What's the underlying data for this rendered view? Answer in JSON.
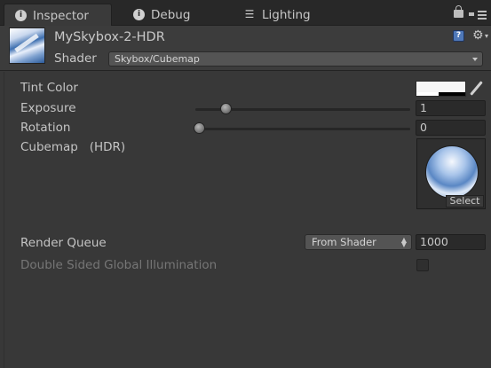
{
  "tabs": [
    {
      "label": "Inspector",
      "icon": "info-icon",
      "active": true
    },
    {
      "label": "Debug",
      "icon": "info-icon",
      "active": false
    },
    {
      "label": "Lighting",
      "icon": "lighting-icon",
      "active": false
    }
  ],
  "header": {
    "asset_name": "MySkybox-2-HDR",
    "shader_label": "Shader",
    "shader_value": "Skybox/Cubemap"
  },
  "properties": {
    "tint_color": {
      "label": "Tint Color",
      "color": "#f6f6f6"
    },
    "exposure": {
      "label": "Exposure",
      "value": "1",
      "slider_fraction": 0.13
    },
    "rotation": {
      "label": "Rotation",
      "value": "0",
      "slider_fraction": 0.0
    },
    "cubemap": {
      "label": "Cubemap   (HDR)",
      "select_label": "Select"
    },
    "render_queue": {
      "label": "Render Queue",
      "mode": "From Shader",
      "value": "1000"
    },
    "double_sided_gi": {
      "label": "Double Sided Global Illumination",
      "checked": false
    }
  },
  "colors": {
    "panel_bg": "#383838",
    "tabbar_bg": "#282828",
    "text": "#c4c4c4",
    "disabled_text": "#767676"
  }
}
